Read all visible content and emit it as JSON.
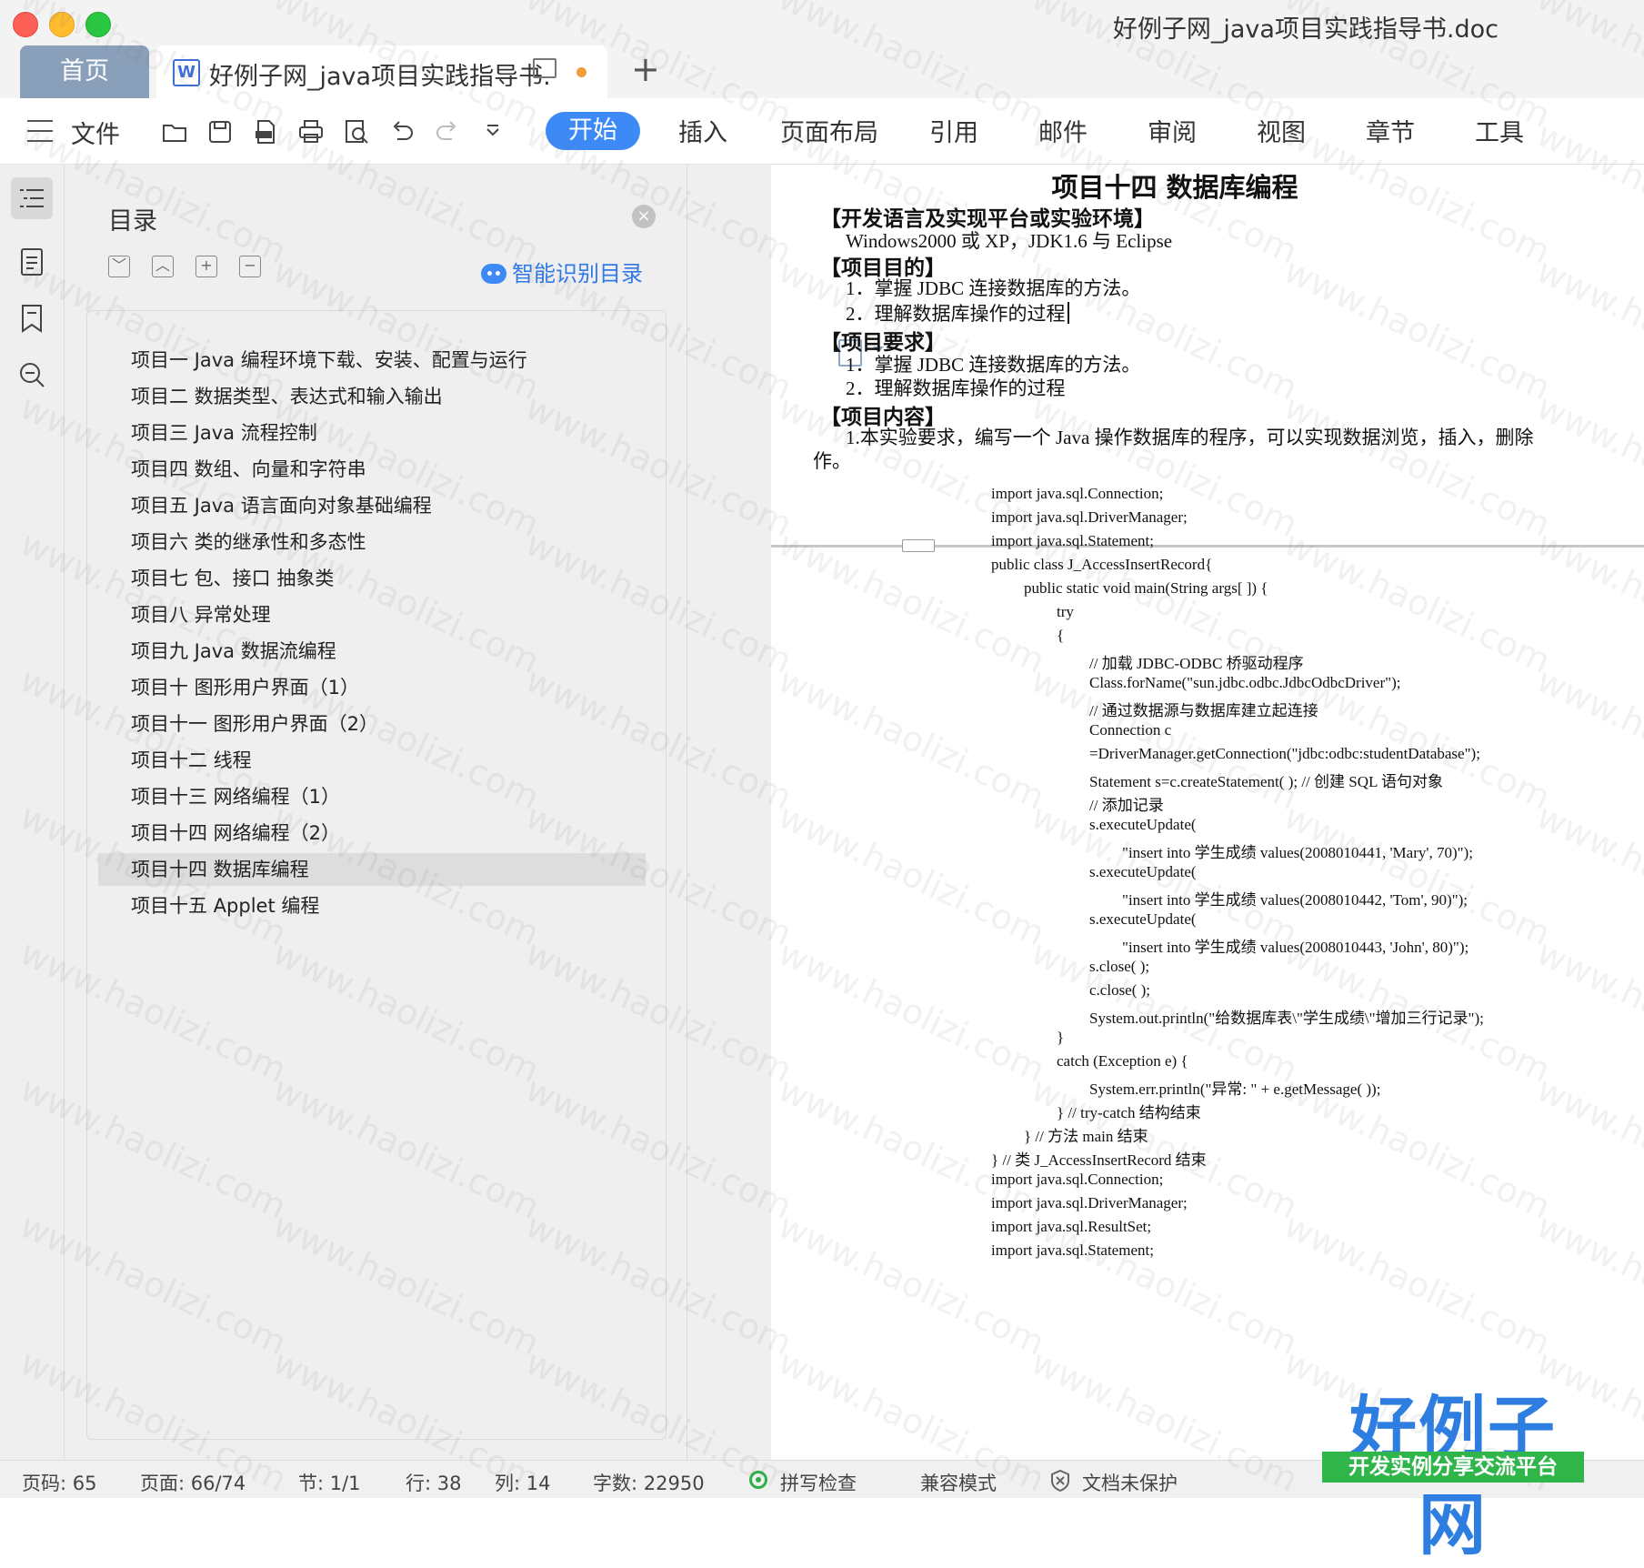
{
  "window": {
    "title": "好例子网_java项目实践指导书.doc"
  },
  "tabs": {
    "home_label": "首页",
    "document_label": "好例子网_java项目实践指导书.",
    "doc_icon_glyph": "W",
    "add_glyph": "+"
  },
  "toolbar": {
    "file_label": "文件",
    "ribbon": [
      "开始",
      "插入",
      "页面布局",
      "引用",
      "邮件",
      "审阅",
      "视图",
      "章节",
      "工具"
    ],
    "active_ribbon": "开始"
  },
  "toc": {
    "title": "目录",
    "close_glyph": "×",
    "smart_label": "智能识别目录",
    "controls": [
      "﹀",
      "︿",
      "+",
      "−"
    ],
    "items": [
      "项目一  Java 编程环境下载、安装、配置与运行",
      "项目二  数据类型、表达式和输入输出",
      "项目三  Java 流程控制",
      "项目四  数组、向量和字符串",
      "项目五  Java 语言面向对象基础编程",
      "项目六  类的继承性和多态性",
      "项目七  包、接口  抽象类",
      "项目八  异常处理",
      "项目九  Java 数据流编程",
      "项目十  图形用户界面（1）",
      "项目十一  图形用户界面（2）",
      "项目十二    线程",
      "项目十三  网络编程（1）",
      "项目十四  网络编程（2）",
      "项目十四  数据库编程",
      "项目十五  Applet 编程"
    ],
    "active_index": 14
  },
  "document": {
    "title": "项目十四  数据库编程",
    "lines": [
      {
        "text": "【开发语言及实现平台或实验环境】",
        "kind": "heading"
      },
      {
        "text": "Windows2000  或 XP，JDK1.6 与 Eclipse",
        "kind": "body"
      },
      {
        "text": "【项目目的】",
        "kind": "heading"
      },
      {
        "text": "1．掌握 JDBC 连接数据库的方法。",
        "kind": "body"
      },
      {
        "text": "2．理解数据库操作的过程",
        "kind": "body"
      },
      {
        "text": "【项目要求】",
        "kind": "heading"
      },
      {
        "text": "1．掌握 JDBC 连接数据库的方法。",
        "kind": "body"
      },
      {
        "text": "2．理解数据库操作的过程",
        "kind": "body"
      },
      {
        "text": "【项目内容】",
        "kind": "heading"
      },
      {
        "text": "1.本实验要求，编写一个 Java 操作数据库的程序，可以实现数据浏览，插入，删除",
        "kind": "body"
      },
      {
        "text": "作。",
        "kind": "body"
      }
    ],
    "code": [
      "import java.sql.Connection;",
      "import java.sql.DriverManager;",
      "import java.sql.Statement;",
      "public class J_AccessInsertRecord{",
      "public static void main(String args[ ]) {",
      "try",
      "{",
      "//  加载 JDBC-ODBC 桥驱动程序",
      "Class.forName(\"sun.jdbc.odbc.JdbcOdbcDriver\");",
      "//  通过数据源与数据库建立起连接",
      "Connection c",
      "=DriverManager.getConnection(\"jdbc:odbc:studentDatabase\");",
      "Statement s=c.createStatement( ); //  创建 SQL 语句对象",
      "//  添加记录",
      "s.executeUpdate(",
      "\"insert into  学生成绩  values(2008010441, 'Mary', 70)\");",
      "s.executeUpdate(",
      "\"insert into  学生成绩  values(2008010442, 'Tom',    90)\");",
      "s.executeUpdate(",
      "\"insert into  学生成绩  values(2008010443, 'John',    80)\");",
      "s.close( );",
      "c.close( );",
      "System.out.println(\"给数据库表\\\"学生成绩\\\"增加三行记录\");",
      "}",
      "catch  (Exception e)    {",
      "System.err.println(\"异常: \" + e.getMessage( ));",
      "} // try-catch 结构结束",
      "} //  方法  main 结束",
      "} //  类  J_AccessInsertRecord 结束",
      "import java.sql.Connection;",
      "import java.sql.DriverManager;",
      "import java.sql.ResultSet;",
      "import java.sql.Statement;"
    ],
    "code_indent": [
      0,
      0,
      0,
      0,
      1,
      2,
      2,
      3,
      3,
      3,
      3,
      3,
      3,
      3,
      3,
      4,
      3,
      4,
      3,
      4,
      3,
      3,
      3,
      2,
      2,
      3,
      2,
      1,
      0,
      0,
      0,
      0,
      0
    ]
  },
  "status": {
    "page_code": "页码: 65",
    "page": "页面: 66/74",
    "section": "节: 1/1",
    "row": "行: 38",
    "col": "列: 14",
    "words": "字数: 22950",
    "spell": "拼写检查",
    "compat": "兼容模式",
    "protect": "文档未保护"
  },
  "watermark": {
    "text": "www.haolizi.com"
  },
  "logo": {
    "main": "好例子网",
    "sub": "开发实例分享交流平台"
  },
  "colors": {
    "accent": "#3d8af7",
    "home_tab": "#8a9fb9",
    "logo_blue": "#2e7de0",
    "logo_green": "#2fb54a"
  }
}
